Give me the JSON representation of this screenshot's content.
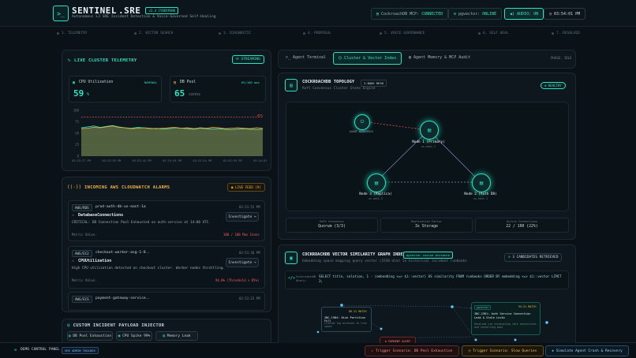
{
  "header": {
    "logo": "SENTINEL",
    "logo_accent": ".SRE",
    "version": "v3.4 CYBERPUNK",
    "subtitle": "Autonomous L3 SRE Incident Detection & Voice-Governed Self-Healing",
    "status_mcp_label": "CockroachDB MCP:",
    "status_mcp_value": "CONNECTED",
    "status_agent_label": "pgvector:",
    "status_agent_value": "ONLINE",
    "audio_label": "AUDIO: ON",
    "clock": "03:54:01 PM"
  },
  "pipeline": {
    "steps": [
      "1. TELEMETRY",
      "2. VECTOR SEARCH",
      "3. DIAGNOSTIC",
      "4. PROPOSAL",
      "5. VOICE GOVERNANCE",
      "6. SELF HEAL",
      "7. RESOLVED"
    ]
  },
  "telemetry": {
    "title": "LIVE CLUSTER TELEMETRY",
    "streaming": "STREAMING",
    "cpu_label": "CPU Utilization",
    "cpu_state": "NOMINAL",
    "cpu_value": "59",
    "cpu_unit": "%",
    "db_label": "DB Pool",
    "db_state": "65/100 max",
    "db_value": "65",
    "db_unit": "conns",
    "threshold_label": "85%"
  },
  "chart_data": {
    "type": "area",
    "x": [
      "03:53:27 PM",
      "03:53:36 PM",
      "03:53:44 PM",
      "03:53:49 PM",
      "03:53:54 PM",
      "03:53:59 PM",
      "03:54:01 PM"
    ],
    "yticks": [
      0,
      25,
      50,
      75,
      100
    ],
    "ylim": [
      0,
      100
    ],
    "threshold": 85,
    "series": [
      {
        "values": [
          62,
          64,
          66,
          63,
          65,
          67,
          64,
          62,
          61,
          63,
          62,
          60,
          61,
          59,
          60,
          62,
          61,
          60,
          59,
          61,
          60,
          59,
          60,
          59,
          58,
          59,
          60,
          59,
          58,
          59
        ]
      },
      {
        "values": [
          60,
          61,
          63,
          62,
          64,
          66,
          63,
          62,
          60,
          61,
          62,
          61,
          60,
          61,
          62,
          63,
          61,
          62,
          60,
          62,
          61,
          63,
          62,
          60,
          61,
          62,
          61,
          60,
          62,
          61
        ]
      }
    ]
  },
  "alarms": {
    "title": "INCOMING AWS CLOUDWATCH ALARMS",
    "live_feed": "LIVE FEED (9)",
    "items": [
      {
        "service": "AWS/RDS",
        "resource": "prod-auth-db-us-east-1a",
        "time": "03:53:53 PM",
        "name": "DatabaseConnections",
        "action": "Investigate →",
        "desc": "CRITICAL: DB Connection Pool Exhausted on auth-service at 14:00 UTC.",
        "metric_label": "Metric Value:",
        "metric_value": "100 / 100 Max Conns"
      },
      {
        "service": "AWS/EC2",
        "resource": "checkout-worker-asg-1-8..",
        "time": "03:53:36 PM",
        "name": "CPUUtilization",
        "action": "Investigate →",
        "desc": "High CPU utilization detected on checkout cluster. Worker nodes throttling.",
        "metric_label": "Metric Value:",
        "metric_value": "94.0% (Threshold > 85%)"
      },
      {
        "service": "AWS/ECS",
        "resource": "payment-gateway-service..",
        "time": "03:53:23 PM"
      }
    ]
  },
  "injector": {
    "title": "CUSTOM INCIDENT PAYLOAD INJECTOR",
    "buttons": [
      "DB Pool Exhaustion",
      "CPU Spike 99%",
      "Memory Leak"
    ]
  },
  "demo": {
    "label": "DEMO CONTROL PANEL",
    "badge": "SRE ADMIN TOOLBOX",
    "trigger1": "Trigger Scenario: DB Pool Exhaustion",
    "trigger2": "Trigger Scenario: Slow Queries",
    "trigger3": "Simulate Agent Crash & Recovery"
  },
  "tabs": {
    "items": [
      "Agent Terminal",
      "Cluster & Vector Index",
      "Agent Memory & MCP Audit"
    ],
    "phase": "PHASE: IDLE"
  },
  "topology": {
    "title": "COCKROACHDB TOPOLOGY",
    "mode": "3-NODE MESH",
    "subtitle": "Raft Consensus Cluster State Engine",
    "status": "HEALTHY",
    "agent_label": "AGENT WORKSPACE",
    "nodes": [
      {
        "name": "Node 1 (Primary)",
        "sub": "us-east-1"
      },
      {
        "name": "Node 3 (Replica)",
        "sub": "us-west-2"
      },
      {
        "name": "Node 2 (Auth DB)",
        "sub": "us-east-1"
      }
    ],
    "stats": [
      {
        "label": "Raft Consensus",
        "value": "Quorum (3/3)"
      },
      {
        "label": "Replication Factor",
        "value": "3x Storage"
      },
      {
        "label": "Active Connections",
        "value": "22 / 100 (22%)"
      }
    ]
  },
  "vector": {
    "title": "COCKROACHDB VECTOR SIMILARITY GRAPH INDEX",
    "badge": "pgvector cosine distance",
    "subtitle": "Embedding space mapping query vector (1536-dim) to historical incident runbooks",
    "candidates": "3 CANDIDATES RETRIEVED",
    "query_label": "CockroachDB Query:",
    "query": "SELECT title, solution, 1 - (embedding <=> $1::vector) AS similarity FROM runbooks ORDER BY embedding <=> $1::vector LIMIT 3;",
    "card1_tag": "pgvector",
    "card1_score": "94.2% MATCH",
    "card1_title": "INC-2301: Auth Service Connection Leak & Stale Locks",
    "card1_desc": "Resolved via terminating idle connections and restarting pool",
    "card2_score": "88.2% MATCH",
    "card2_title": "INC-1984: Disk Partition Full",
    "card2_desc": "Cleared log archives to free space",
    "current_alert": "CURRENT ALERT",
    "card3_title": "INC-????: Checkout Latency"
  }
}
